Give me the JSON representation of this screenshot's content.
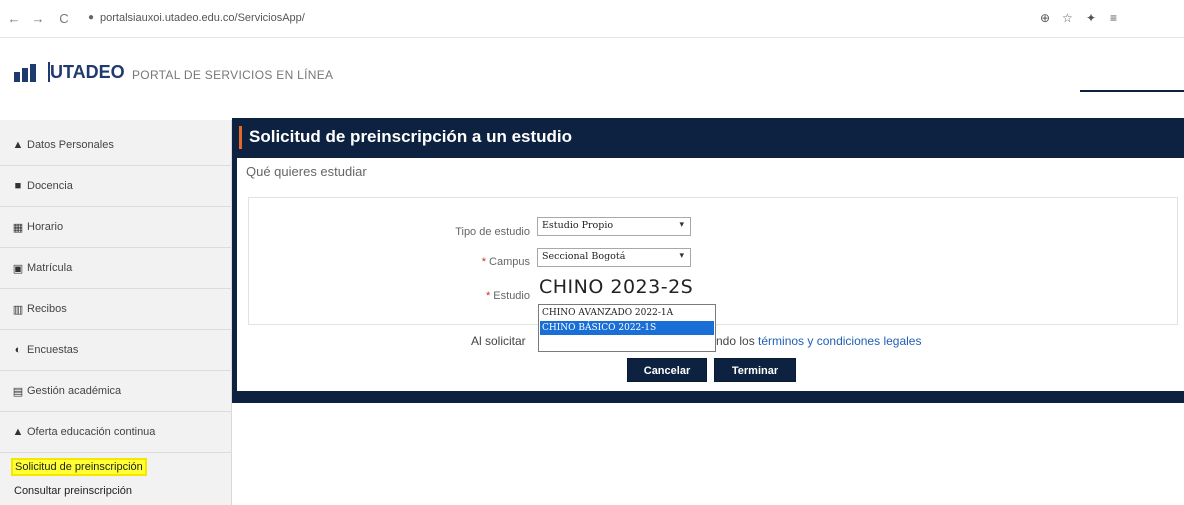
{
  "browser": {
    "url": "portalsiauxoi.utadeo.edu.co/ServiciosApp/",
    "back_icon": "←",
    "forward_icon": "→",
    "reload_icon": "C",
    "lock_icon": "🔒",
    "right_icons": [
      "⊕",
      "☆",
      "✦",
      "≡"
    ]
  },
  "header": {
    "logo_text": "UTADEO",
    "portal_title": "PORTAL DE SERVICIOS EN LÍNEA"
  },
  "sidebar": {
    "items": [
      {
        "label": "Datos Personales",
        "icon": "person-icon",
        "glyph": "👤"
      },
      {
        "label": "Docencia",
        "icon": "book-icon",
        "glyph": "■"
      },
      {
        "label": "Horario",
        "icon": "calendar-icon",
        "glyph": "▦"
      },
      {
        "label": "Matrícula",
        "icon": "id-card-icon",
        "glyph": "▣"
      },
      {
        "label": "Recibos",
        "icon": "barcode-icon",
        "glyph": "▥"
      },
      {
        "label": "Encuestas",
        "icon": "pie-icon",
        "glyph": "◐"
      },
      {
        "label": "Gestión académica",
        "icon": "clipboard-icon",
        "glyph": "▤"
      },
      {
        "label": "Oferta educación continua",
        "icon": "graduation-cap-icon",
        "glyph": "▲"
      }
    ],
    "sub_items": [
      {
        "label": "Solicitud de preinscripción",
        "active": true
      },
      {
        "label": "Consultar preinscripción",
        "active": false
      }
    ]
  },
  "main": {
    "title": "Solicitud de preinscripción a un estudio",
    "section_title": "Qué quieres estudiar",
    "form": {
      "tipo_label": "Tipo de estudio",
      "tipo_value": "Estudio Propio",
      "campus_label": "Campus",
      "campus_value": "Seccional Bogotá",
      "estudio_label": "Estudio",
      "estudio_value": "CHINO 2023-2S",
      "required_mark": "*",
      "estudio_options": [
        {
          "label": "CHINO AVANZADO 2022-1A",
          "selected": false
        },
        {
          "label": "CHINO BÁSICO 2022-1S",
          "selected": true
        },
        {
          "label": "",
          "selected": false
        }
      ]
    },
    "legal_prefix": "Al solicitar",
    "legal_middle": "ndo los",
    "legal_link": "términos y condiciones legales",
    "cancel_label": "Cancelar",
    "finish_label": "Terminar"
  },
  "colors": {
    "navy": "#0d2240",
    "accent_orange": "#e8672a",
    "highlight_yellow": "#ffff33",
    "selection_blue": "#1a6fd6",
    "link_blue": "#1f5fb5"
  }
}
